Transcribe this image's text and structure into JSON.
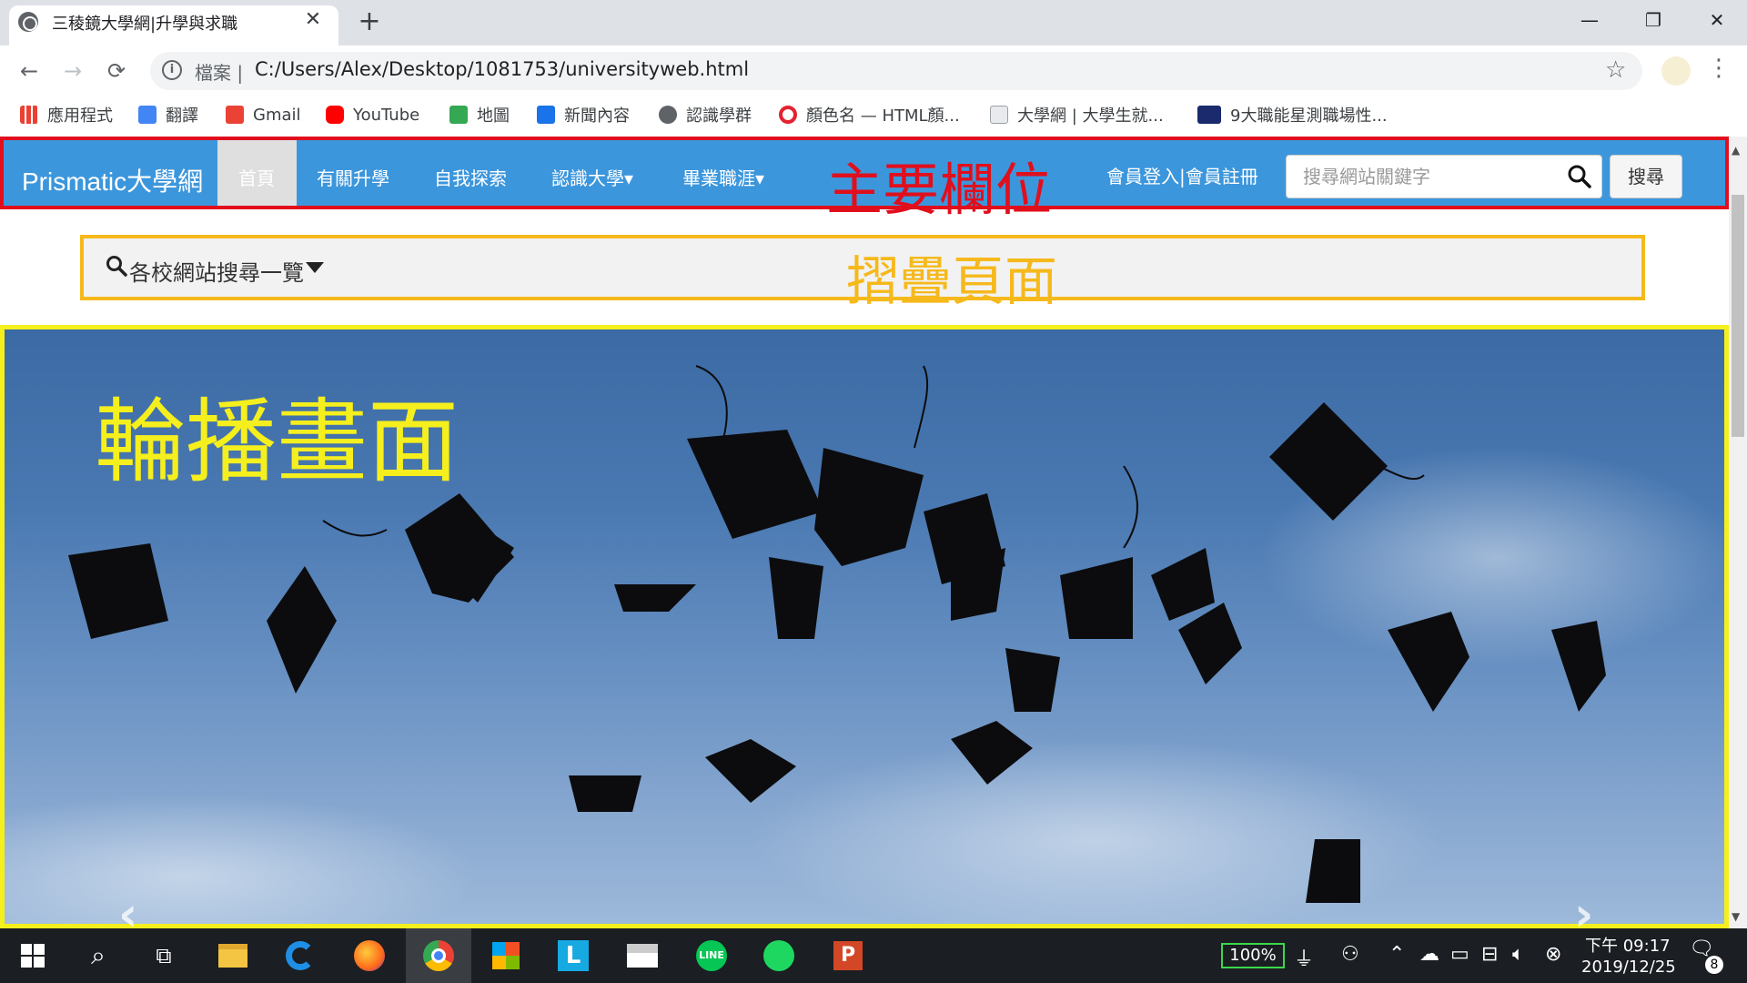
{
  "browser": {
    "tab_title": "三稜鏡大學網|升學與求職",
    "new_tab": "+",
    "tab_close": "✕",
    "window_controls": {
      "minimize": "—",
      "restore": "❐",
      "close": "✕"
    },
    "url_prefix": "檔案 |",
    "url": "C:/Users/Alex/Desktop/1081753/universityweb.html",
    "bookmarks": [
      {
        "label": "應用程式",
        "color": "#e94235"
      },
      {
        "label": "翻譯",
        "color": "#4285f4"
      },
      {
        "label": "Gmail",
        "color": "#ea4335"
      },
      {
        "label": "YouTube",
        "color": "#ff0000"
      },
      {
        "label": "地圖",
        "color": "#34a853"
      },
      {
        "label": "新聞內容",
        "color": "#1a73e8"
      },
      {
        "label": "認識學群",
        "color": "#5f6368"
      },
      {
        "label": "顏色名 — HTML顏...",
        "color": "#e3232f"
      },
      {
        "label": "大學網 | 大學生就...",
        "color": "#9aa0a6"
      },
      {
        "label": "9大職能星測職場性...",
        "color": "#1a2a6c"
      }
    ]
  },
  "page": {
    "brand": "Prismatic大學網",
    "nav": [
      {
        "label": "首頁"
      },
      {
        "label": "有關升學"
      },
      {
        "label": "自我探索"
      },
      {
        "label": "認識大學▾"
      },
      {
        "label": "畢業職涯▾"
      }
    ],
    "main_annotation": "主要欄位",
    "member_links": "會員登入|會員註冊",
    "search_placeholder": "搜尋網站關鍵字",
    "search_button": "搜尋",
    "collapse_text": "各校網站搜尋一覽",
    "collapse_annotation": "摺疊頁面",
    "carousel_annotation": "輪播畫面",
    "carousel_prev": "‹",
    "carousel_next": "›"
  },
  "taskbar": {
    "battery": "100%",
    "time": "下午 09:17",
    "date": "2019/12/25",
    "notification_count": "8"
  },
  "colors": {
    "navbar": "#3c96dc",
    "annotation_red": "#e10f1c",
    "annotation_orange": "#f6b91c",
    "annotation_yellow": "#f5ef1d"
  }
}
